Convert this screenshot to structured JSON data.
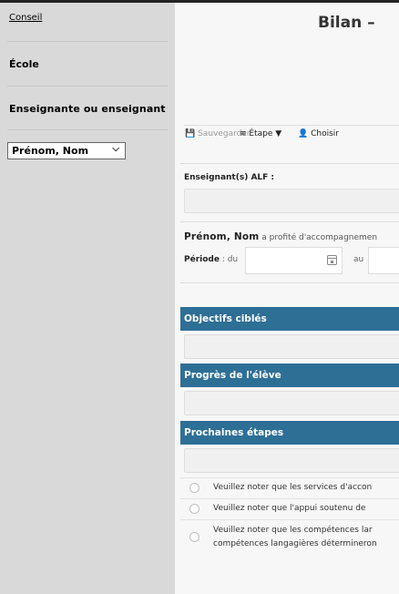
{
  "sidebar": {
    "link": "Conseil",
    "ecole": "École",
    "enseignant": "Enseignante ou enseignant",
    "select_value": "Prénom, Nom"
  },
  "main": {
    "title": "Bilan –",
    "toolbar": {
      "save": "Sauvegarder",
      "etape": "Étape",
      "choisir": "Choisir"
    },
    "alf_label": "Enseignant(s) ALF :",
    "student_name": "Prénom, Nom",
    "student_text": " a profité d'accompagnemen",
    "periode_label": "Période",
    "periode_du": " : du",
    "periode_au": "au",
    "sections": [
      {
        "title": "Objectifs ciblés"
      },
      {
        "title": "Progrès de l'élève"
      },
      {
        "title": "Prochaines étapes"
      }
    ],
    "options": [
      {
        "text": "Veuillez noter que les services d'accon"
      },
      {
        "text": "Veuillez noter que l'appui soutenu de "
      },
      {
        "text": "Veuillez noter que les compétences lar",
        "text2": "compétences langagières détermineron"
      }
    ]
  },
  "colors": {
    "section_header": "#2e6f96",
    "sidebar": "#d9d9d9"
  }
}
